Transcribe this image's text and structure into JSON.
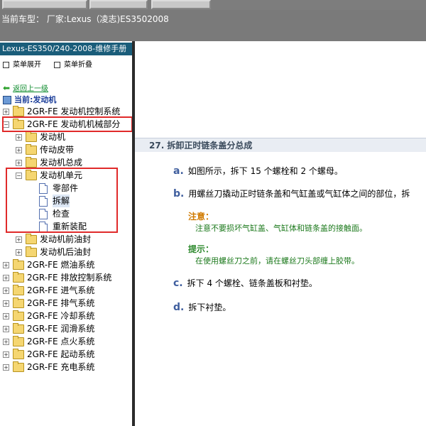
{
  "vehicle_bar": {
    "text": "当前车型： 厂家:Lexus（凌志)ES3502008"
  },
  "sidebar": {
    "title": "Lexus-ES350/240-2008-维修手册",
    "expand_all": "菜单展开",
    "collapse_all": "菜单折叠",
    "back_link": "返回上一级",
    "current": "当前:发动机",
    "tree": [
      {
        "label": "2GR-FE 发动机控制系统"
      },
      {
        "label": "2GR-FE 发动机机械部分"
      },
      {
        "label": "发动机"
      },
      {
        "label": "传动皮带"
      },
      {
        "label": "发动机总成"
      },
      {
        "label": "发动机单元"
      },
      {
        "label": "零部件"
      },
      {
        "label": "拆解"
      },
      {
        "label": "检查"
      },
      {
        "label": "重新装配"
      },
      {
        "label": "发动机前油封"
      },
      {
        "label": "发动机后油封"
      },
      {
        "label": "2GR-FE 燃油系统"
      },
      {
        "label": "2GR-FE 排放控制系统"
      },
      {
        "label": "2GR-FE 进气系统"
      },
      {
        "label": "2GR-FE 排气系统"
      },
      {
        "label": "2GR-FE 冷却系统"
      },
      {
        "label": "2GR-FE 润滑系统"
      },
      {
        "label": "2GR-FE 点火系统"
      },
      {
        "label": "2GR-FE 起动系统"
      },
      {
        "label": "2GR-FE 充电系统"
      }
    ]
  },
  "content": {
    "section_title": "27. 拆卸正时链条盖分总成",
    "steps": [
      {
        "marker": "a.",
        "text": "如图所示，拆下 15 个螺栓和 2 个螺母。"
      },
      {
        "marker": "b.",
        "text": "用螺丝刀撬动正时链条盖和气缸盖或气缸体之间的部位，拆"
      },
      {
        "marker": "c.",
        "text": "拆下 4 个螺栓、链条盖板和衬垫。"
      },
      {
        "marker": "d.",
        "text": "拆下衬垫。"
      }
    ],
    "caution": {
      "title": "注意：",
      "body": "注意不要损坏气缸盖、气缸体和链条盖的接触面。"
    },
    "tip": {
      "title": "提示：",
      "body": "在使用螺丝刀之前，请在螺丝刀头部缠上胶带。"
    }
  }
}
